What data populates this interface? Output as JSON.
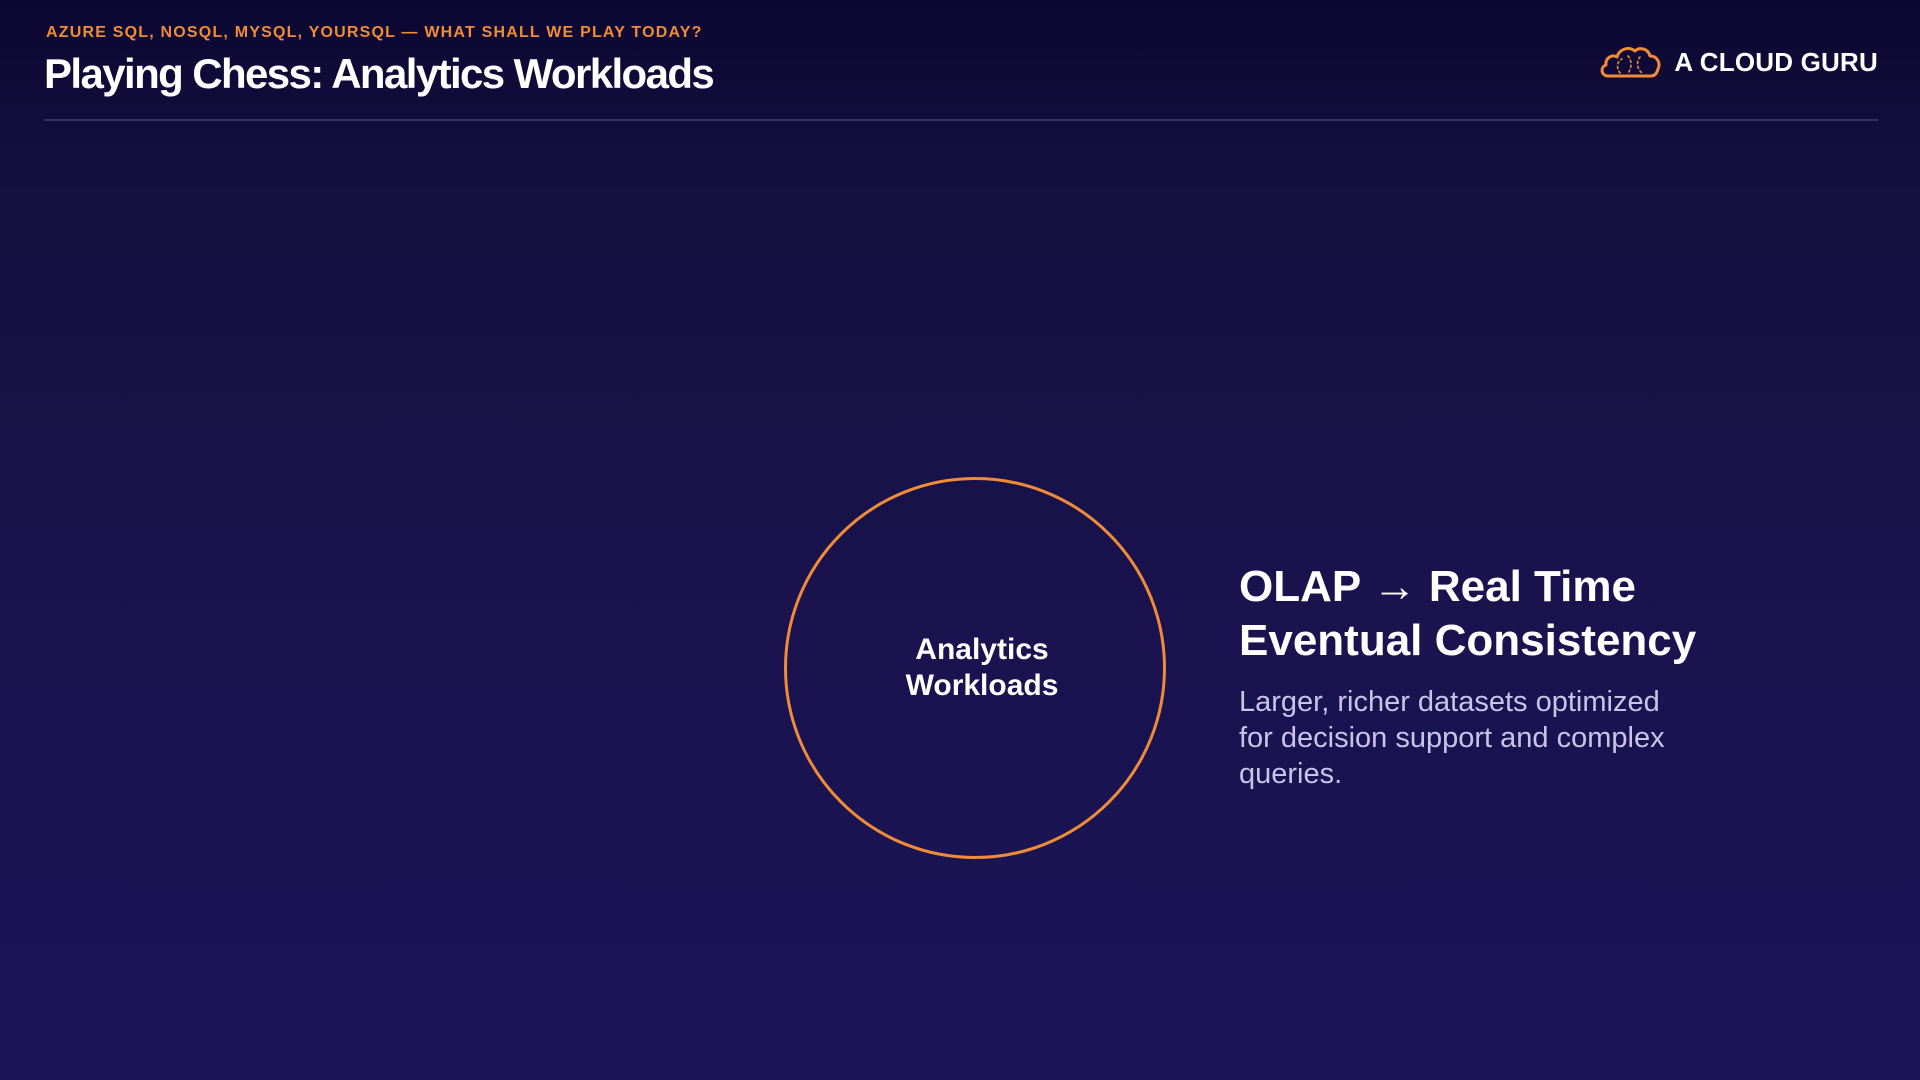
{
  "header": {
    "kicker": "AZURE SQL, NOSQL, MYSQL, YOURSQL — WHAT SHALL WE PLAY TODAY?",
    "title": "Playing Chess: Analytics Workloads"
  },
  "logo": {
    "text": "A CLOUD GURU",
    "icon": "cloud-icon"
  },
  "diagram": {
    "circle_label": "Analytics Workloads"
  },
  "info": {
    "heading_line1": "OLAP → Real Time",
    "heading_line2": "Eventual Consistency",
    "body": "Larger, richer datasets optimized for decision support and complex queries."
  },
  "colors": {
    "accent": "#f08c37",
    "background": "#1a1350",
    "text": "#ffffff",
    "muted_text": "#c9c3e6"
  }
}
